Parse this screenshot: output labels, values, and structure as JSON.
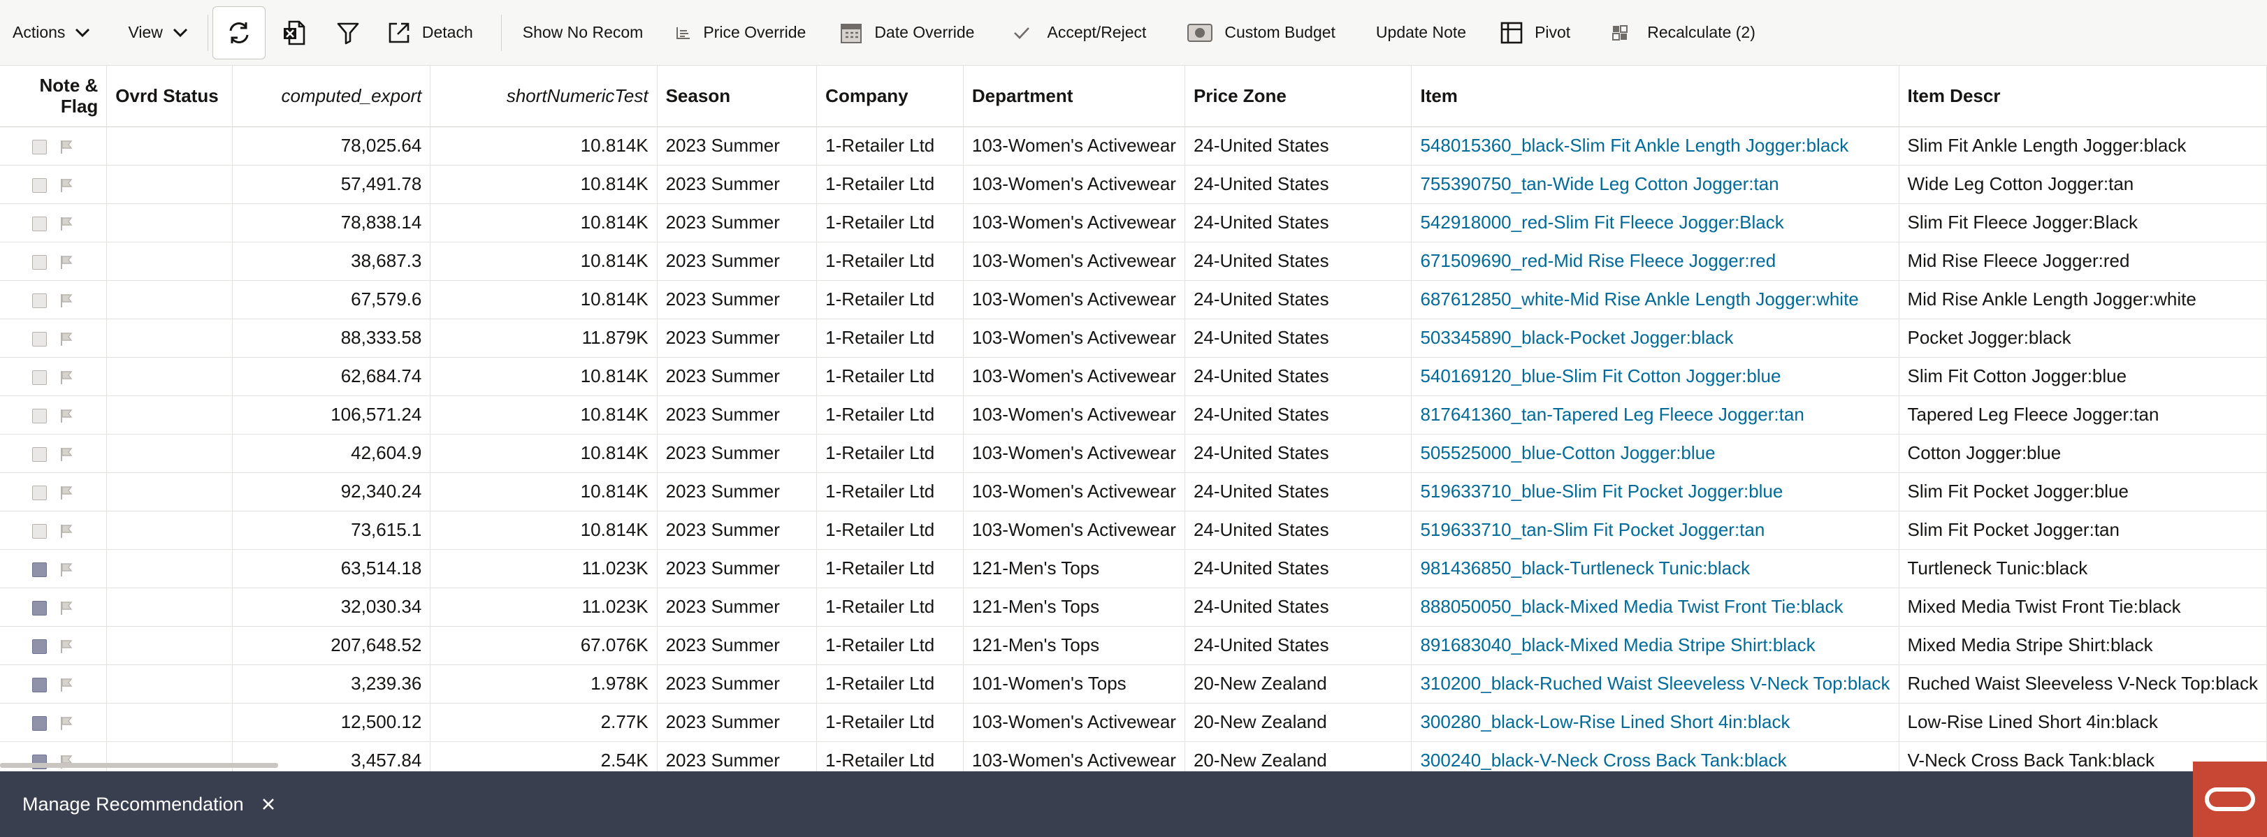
{
  "toolbar": {
    "actions_label": "Actions",
    "view_label": "View",
    "detach_label": "Detach",
    "show_no_recom_label": "Show No Recom",
    "price_override_label": "Price Override",
    "date_override_label": "Date Override",
    "accept_reject_label": "Accept/Reject",
    "custom_budget_label": "Custom Budget",
    "update_note_label": "Update Note",
    "pivot_label": "Pivot",
    "recalculate_label": "Recalculate (2)",
    "icons": [
      "chevron-down-icon",
      "refresh-icon",
      "export-excel-icon",
      "filter-icon",
      "detach-icon",
      "price-override-icon",
      "calendar-icon",
      "checkmark-icon",
      "budget-icon",
      "pivot-icon",
      "recalculate-icon"
    ]
  },
  "grid": {
    "headers": {
      "note_flag_line1": "Note &",
      "note_flag_line2": "Flag",
      "ovrd_status": "Ovrd Status",
      "computed_export": "computed_export",
      "short_numeric_test": "shortNumericTest",
      "season": "Season",
      "company": "Company",
      "department": "Department",
      "price_zone": "Price Zone",
      "item": "Item",
      "item_descr": "Item Descr"
    },
    "rows": [
      {
        "checked": false,
        "ovrd_status": "",
        "computed_export": "78,025.64",
        "short_numeric_test": "10.814K",
        "season": "2023 Summer",
        "company": "1-Retailer Ltd",
        "department": "103-Women's Activewear",
        "price_zone": "24-United States",
        "item": "548015360_black-Slim Fit Ankle Length Jogger:black",
        "item_descr": "Slim Fit Ankle Length Jogger:black"
      },
      {
        "checked": false,
        "ovrd_status": "",
        "computed_export": "57,491.78",
        "short_numeric_test": "10.814K",
        "season": "2023 Summer",
        "company": "1-Retailer Ltd",
        "department": "103-Women's Activewear",
        "price_zone": "24-United States",
        "item": "755390750_tan-Wide Leg Cotton Jogger:tan",
        "item_descr": "Wide Leg Cotton Jogger:tan"
      },
      {
        "checked": false,
        "ovrd_status": "",
        "computed_export": "78,838.14",
        "short_numeric_test": "10.814K",
        "season": "2023 Summer",
        "company": "1-Retailer Ltd",
        "department": "103-Women's Activewear",
        "price_zone": "24-United States",
        "item": "542918000_red-Slim Fit Fleece Jogger:Black",
        "item_descr": "Slim Fit Fleece Jogger:Black"
      },
      {
        "checked": false,
        "ovrd_status": "",
        "computed_export": "38,687.3",
        "short_numeric_test": "10.814K",
        "season": "2023 Summer",
        "company": "1-Retailer Ltd",
        "department": "103-Women's Activewear",
        "price_zone": "24-United States",
        "item": "671509690_red-Mid Rise Fleece Jogger:red",
        "item_descr": "Mid Rise Fleece Jogger:red"
      },
      {
        "checked": false,
        "ovrd_status": "",
        "computed_export": "67,579.6",
        "short_numeric_test": "10.814K",
        "season": "2023 Summer",
        "company": "1-Retailer Ltd",
        "department": "103-Women's Activewear",
        "price_zone": "24-United States",
        "item": "687612850_white-Mid Rise Ankle Length Jogger:white",
        "item_descr": "Mid Rise Ankle Length Jogger:white"
      },
      {
        "checked": false,
        "ovrd_status": "",
        "computed_export": "88,333.58",
        "short_numeric_test": "11.879K",
        "season": "2023 Summer",
        "company": "1-Retailer Ltd",
        "department": "103-Women's Activewear",
        "price_zone": "24-United States",
        "item": "503345890_black-Pocket Jogger:black",
        "item_descr": "Pocket Jogger:black"
      },
      {
        "checked": false,
        "ovrd_status": "",
        "computed_export": "62,684.74",
        "short_numeric_test": "10.814K",
        "season": "2023 Summer",
        "company": "1-Retailer Ltd",
        "department": "103-Women's Activewear",
        "price_zone": "24-United States",
        "item": "540169120_blue-Slim Fit Cotton Jogger:blue",
        "item_descr": "Slim Fit Cotton Jogger:blue"
      },
      {
        "checked": false,
        "ovrd_status": "",
        "computed_export": "106,571.24",
        "short_numeric_test": "10.814K",
        "season": "2023 Summer",
        "company": "1-Retailer Ltd",
        "department": "103-Women's Activewear",
        "price_zone": "24-United States",
        "item": "817641360_tan-Tapered Leg Fleece Jogger:tan",
        "item_descr": "Tapered Leg Fleece Jogger:tan"
      },
      {
        "checked": false,
        "ovrd_status": "",
        "computed_export": "42,604.9",
        "short_numeric_test": "10.814K",
        "season": "2023 Summer",
        "company": "1-Retailer Ltd",
        "department": "103-Women's Activewear",
        "price_zone": "24-United States",
        "item": "505525000_blue-Cotton Jogger:blue",
        "item_descr": "Cotton Jogger:blue"
      },
      {
        "checked": false,
        "ovrd_status": "",
        "computed_export": "92,340.24",
        "short_numeric_test": "10.814K",
        "season": "2023 Summer",
        "company": "1-Retailer Ltd",
        "department": "103-Women's Activewear",
        "price_zone": "24-United States",
        "item": "519633710_blue-Slim Fit Pocket Jogger:blue",
        "item_descr": "Slim Fit Pocket Jogger:blue"
      },
      {
        "checked": false,
        "ovrd_status": "",
        "computed_export": "73,615.1",
        "short_numeric_test": "10.814K",
        "season": "2023 Summer",
        "company": "1-Retailer Ltd",
        "department": "103-Women's Activewear",
        "price_zone": "24-United States",
        "item": "519633710_tan-Slim Fit Pocket Jogger:tan",
        "item_descr": "Slim Fit Pocket Jogger:tan"
      },
      {
        "checked": true,
        "ovrd_status": "",
        "computed_export": "63,514.18",
        "short_numeric_test": "11.023K",
        "season": "2023 Summer",
        "company": "1-Retailer Ltd",
        "department": "121-Men's Tops",
        "price_zone": "24-United States",
        "item": "981436850_black-Turtleneck Tunic:black",
        "item_descr": "Turtleneck Tunic:black"
      },
      {
        "checked": true,
        "ovrd_status": "",
        "computed_export": "32,030.34",
        "short_numeric_test": "11.023K",
        "season": "2023 Summer",
        "company": "1-Retailer Ltd",
        "department": "121-Men's Tops",
        "price_zone": "24-United States",
        "item": "888050050_black-Mixed Media Twist Front Tie:black",
        "item_descr": "Mixed Media Twist Front Tie:black"
      },
      {
        "checked": true,
        "ovrd_status": "",
        "computed_export": "207,648.52",
        "short_numeric_test": "67.076K",
        "season": "2023 Summer",
        "company": "1-Retailer Ltd",
        "department": "121-Men's Tops",
        "price_zone": "24-United States",
        "item": "891683040_black-Mixed Media Stripe Shirt:black",
        "item_descr": "Mixed Media Stripe Shirt:black"
      },
      {
        "checked": true,
        "ovrd_status": "",
        "computed_export": "3,239.36",
        "short_numeric_test": "1.978K",
        "season": "2023 Summer",
        "company": "1-Retailer Ltd",
        "department": "101-Women's Tops",
        "price_zone": "20-New Zealand",
        "item": "310200_black-Ruched Waist Sleeveless V-Neck Top:black",
        "item_descr": "Ruched Waist Sleeveless V-Neck Top:black"
      },
      {
        "checked": true,
        "ovrd_status": "",
        "computed_export": "12,500.12",
        "short_numeric_test": "2.77K",
        "season": "2023 Summer",
        "company": "1-Retailer Ltd",
        "department": "103-Women's Activewear",
        "price_zone": "20-New Zealand",
        "item": "300280_black-Low-Rise Lined Short 4in:black",
        "item_descr": "Low-Rise Lined Short 4in:black"
      },
      {
        "checked": true,
        "ovrd_status": "",
        "computed_export": "3,457.84",
        "short_numeric_test": "2.54K",
        "season": "2023 Summer",
        "company": "1-Retailer Ltd",
        "department": "103-Women's Activewear",
        "price_zone": "20-New Zealand",
        "item": "300240_black-V-Neck Cross Back Tank:black",
        "item_descr": "V-Neck Cross Back Tank:black"
      }
    ]
  },
  "drawer": {
    "title": "Manage Recommendation",
    "icons": [
      "close-icon",
      "oracle-logo-icon"
    ]
  },
  "colors": {
    "link": "#006b9a",
    "drawer_bg": "#3a3f4f",
    "brand": "#c74634",
    "checked_box": "#8f92a8"
  }
}
